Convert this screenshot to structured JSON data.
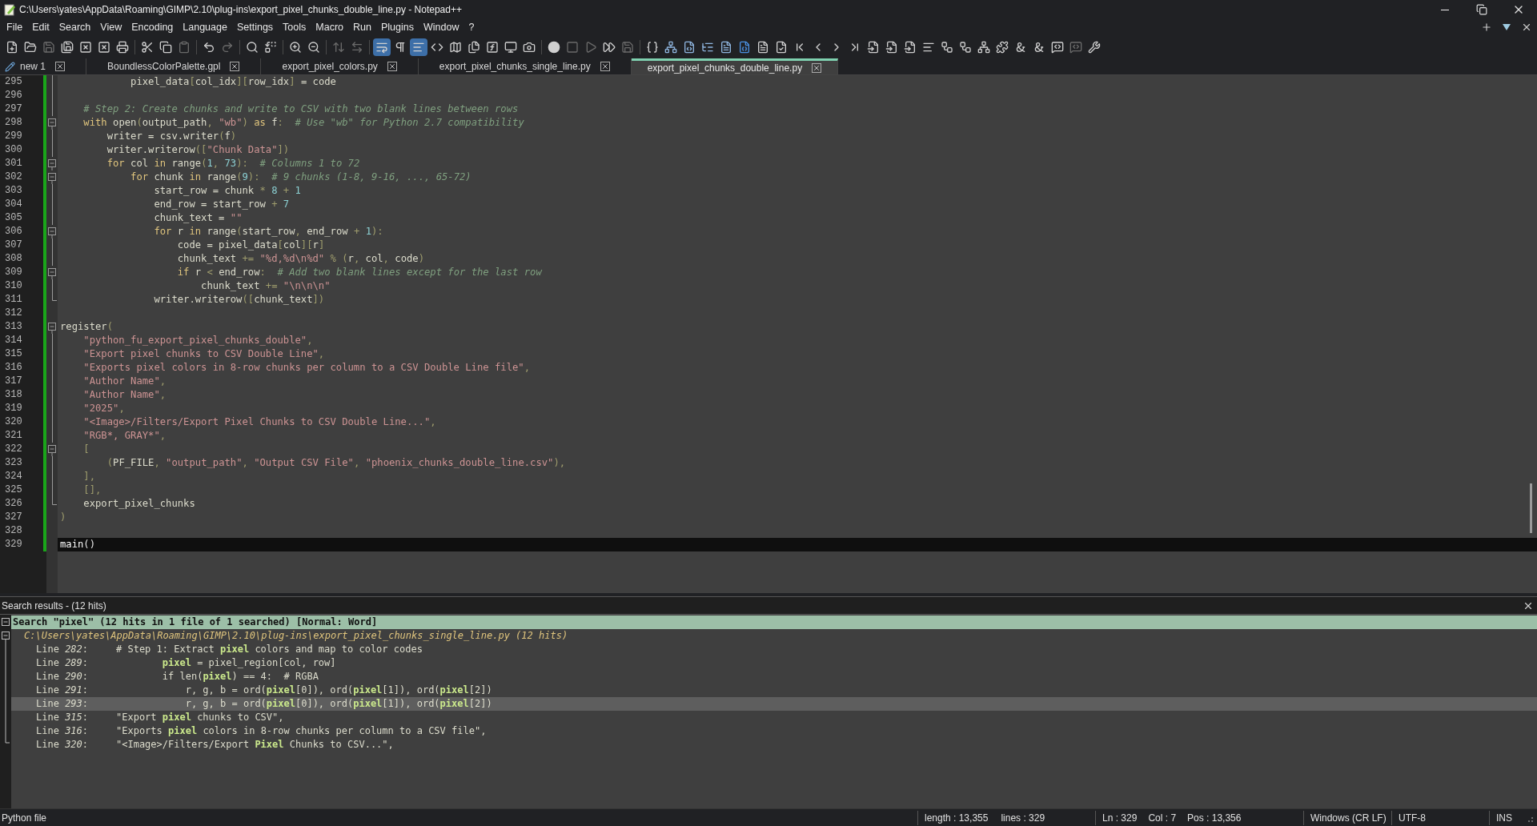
{
  "window": {
    "title": "C:\\Users\\yates\\AppData\\Roaming\\GIMP\\2.10\\plug-ins\\export_pixel_chunks_double_line.py - Notepad++"
  },
  "menu": [
    "File",
    "Edit",
    "Search",
    "View",
    "Encoding",
    "Language",
    "Settings",
    "Tools",
    "Macro",
    "Run",
    "Plugins",
    "Window",
    "?"
  ],
  "toolbar": {
    "word_wrap": {
      "on": true
    },
    "show_all_characters": {
      "on": false
    },
    "indent_guide": {
      "on": true
    }
  },
  "tabs": [
    {
      "label": "new 1",
      "kind": "unsaved",
      "selected": false
    },
    {
      "label": "BoundlessColorPalette.gpl",
      "kind": "file",
      "selected": false
    },
    {
      "label": "export_pixel_colors.py",
      "kind": "file",
      "selected": false
    },
    {
      "label": "export_pixel_chunks_single_line.py",
      "kind": "file",
      "selected": false
    },
    {
      "label": "export_pixel_chunks_double_line.py",
      "kind": "file",
      "selected": true
    }
  ],
  "editor": {
    "lines": [
      {
        "number": "295",
        "kind": "fold_mid",
        "current": false,
        "segments": [
          {
            "kind": "txt",
            "text": "            pixel_data"
          },
          {
            "kind": "op",
            "text": "["
          },
          {
            "kind": "txt",
            "text": "col_idx"
          },
          {
            "kind": "op",
            "text": "]["
          },
          {
            "kind": "txt",
            "text": "row_idx"
          },
          {
            "kind": "op",
            "text": "]"
          },
          {
            "kind": "txt",
            "text": " = code"
          }
        ]
      },
      {
        "number": "296",
        "kind": "fold_mid",
        "current": false
      },
      {
        "number": "297",
        "kind": "fold_mid",
        "current": false,
        "segments": [
          {
            "kind": "com",
            "text": "    # Step 2: Create chunks and write to CSV with two blank lines between rows"
          }
        ]
      },
      {
        "number": "298",
        "kind": "fold_start",
        "current": false,
        "segments": [
          {
            "kind": "kw",
            "text": "    with"
          },
          {
            "kind": "txt",
            "text": " open"
          },
          {
            "kind": "op",
            "text": "("
          },
          {
            "kind": "txt",
            "text": "output_path"
          },
          {
            "kind": "op",
            "text": ", "
          },
          {
            "kind": "str",
            "text": "\"wb\""
          },
          {
            "kind": "op",
            "text": ") "
          },
          {
            "kind": "kw",
            "text": "as"
          },
          {
            "kind": "txt",
            "text": " f"
          },
          {
            "kind": "op",
            "text": ":  "
          },
          {
            "kind": "com",
            "text": "# Use \"wb\" for Python 2.7 compatibility"
          }
        ]
      },
      {
        "number": "299",
        "kind": "fold_mid",
        "current": false,
        "segments": [
          {
            "kind": "txt",
            "text": "        writer = csv.writer"
          },
          {
            "kind": "op",
            "text": "("
          },
          {
            "kind": "txt",
            "text": "f"
          },
          {
            "kind": "op",
            "text": ")"
          }
        ]
      },
      {
        "number": "300",
        "kind": "fold_mid",
        "current": false,
        "segments": [
          {
            "kind": "txt",
            "text": "        writer.writerow"
          },
          {
            "kind": "op",
            "text": "(["
          },
          {
            "kind": "str",
            "text": "\"Chunk Data\""
          },
          {
            "kind": "op",
            "text": "])"
          }
        ]
      },
      {
        "number": "301",
        "kind": "fold_start",
        "current": false,
        "segments": [
          {
            "kind": "kw",
            "text": "        for"
          },
          {
            "kind": "txt",
            "text": " col "
          },
          {
            "kind": "kw",
            "text": "in"
          },
          {
            "kind": "txt",
            "text": " range"
          },
          {
            "kind": "op",
            "text": "("
          },
          {
            "kind": "num",
            "text": "1"
          },
          {
            "kind": "op",
            "text": ", "
          },
          {
            "kind": "num",
            "text": "73"
          },
          {
            "kind": "op",
            "text": "):  "
          },
          {
            "kind": "com",
            "text": "# Columns 1 to 72"
          }
        ]
      },
      {
        "number": "302",
        "kind": "fold_start",
        "current": false,
        "segments": [
          {
            "kind": "kw",
            "text": "            for"
          },
          {
            "kind": "txt",
            "text": " chunk "
          },
          {
            "kind": "kw",
            "text": "in"
          },
          {
            "kind": "txt",
            "text": " range"
          },
          {
            "kind": "op",
            "text": "("
          },
          {
            "kind": "num",
            "text": "9"
          },
          {
            "kind": "op",
            "text": "):  "
          },
          {
            "kind": "com",
            "text": "# 9 chunks (1-8, 9-16, ..., 65-72)"
          }
        ]
      },
      {
        "number": "303",
        "kind": "fold_mid",
        "current": false,
        "segments": [
          {
            "kind": "txt",
            "text": "                start_row = chunk "
          },
          {
            "kind": "op",
            "text": "* "
          },
          {
            "kind": "num",
            "text": "8"
          },
          {
            "kind": "op",
            "text": " + "
          },
          {
            "kind": "num",
            "text": "1"
          }
        ]
      },
      {
        "number": "304",
        "kind": "fold_mid",
        "current": false,
        "segments": [
          {
            "kind": "txt",
            "text": "                end_row = start_row "
          },
          {
            "kind": "op",
            "text": "+ "
          },
          {
            "kind": "num",
            "text": "7"
          }
        ]
      },
      {
        "number": "305",
        "kind": "fold_mid",
        "current": false,
        "segments": [
          {
            "kind": "txt",
            "text": "                chunk_text = "
          },
          {
            "kind": "str",
            "text": "\"\""
          }
        ]
      },
      {
        "number": "306",
        "kind": "fold_start",
        "current": false,
        "segments": [
          {
            "kind": "kw",
            "text": "                for"
          },
          {
            "kind": "txt",
            "text": " r "
          },
          {
            "kind": "kw",
            "text": "in"
          },
          {
            "kind": "txt",
            "text": " range"
          },
          {
            "kind": "op",
            "text": "("
          },
          {
            "kind": "txt",
            "text": "start_row"
          },
          {
            "kind": "op",
            "text": ", "
          },
          {
            "kind": "txt",
            "text": "end_row "
          },
          {
            "kind": "op",
            "text": "+ "
          },
          {
            "kind": "num",
            "text": "1"
          },
          {
            "kind": "op",
            "text": "):"
          }
        ]
      },
      {
        "number": "307",
        "kind": "fold_mid",
        "current": false,
        "segments": [
          {
            "kind": "txt",
            "text": "                    code = pixel_data"
          },
          {
            "kind": "op",
            "text": "["
          },
          {
            "kind": "txt",
            "text": "col"
          },
          {
            "kind": "op",
            "text": "]["
          },
          {
            "kind": "txt",
            "text": "r"
          },
          {
            "kind": "op",
            "text": "]"
          }
        ]
      },
      {
        "number": "308",
        "kind": "fold_mid",
        "current": false,
        "segments": [
          {
            "kind": "txt",
            "text": "                    chunk_text "
          },
          {
            "kind": "op",
            "text": "+= "
          },
          {
            "kind": "str",
            "text": "\"%d,%d\\n%d\""
          },
          {
            "kind": "op",
            "text": " % ("
          },
          {
            "kind": "txt",
            "text": "r"
          },
          {
            "kind": "op",
            "text": ", "
          },
          {
            "kind": "txt",
            "text": "col"
          },
          {
            "kind": "op",
            "text": ", "
          },
          {
            "kind": "txt",
            "text": "code"
          },
          {
            "kind": "op",
            "text": ")"
          }
        ]
      },
      {
        "number": "309",
        "kind": "fold_start",
        "current": false,
        "segments": [
          {
            "kind": "kw",
            "text": "                    if"
          },
          {
            "kind": "txt",
            "text": " r "
          },
          {
            "kind": "op",
            "text": "< "
          },
          {
            "kind": "txt",
            "text": "end_row"
          },
          {
            "kind": "op",
            "text": ":  "
          },
          {
            "kind": "com",
            "text": "# Add two blank lines except for the last row"
          }
        ]
      },
      {
        "number": "310",
        "kind": "fold_mid",
        "current": false,
        "segments": [
          {
            "kind": "txt",
            "text": "                        chunk_text "
          },
          {
            "kind": "op",
            "text": "+= "
          },
          {
            "kind": "str",
            "text": "\"\\n\\n\\n\""
          }
        ]
      },
      {
        "number": "311",
        "kind": "fold_end",
        "current": false,
        "segments": [
          {
            "kind": "txt",
            "text": "                writer.writerow"
          },
          {
            "kind": "op",
            "text": "(["
          },
          {
            "kind": "txt",
            "text": "chunk_text"
          },
          {
            "kind": "op",
            "text": "])"
          }
        ]
      },
      {
        "number": "312",
        "kind": "plain",
        "current": false
      },
      {
        "number": "313",
        "kind": "fold_start",
        "current": false,
        "segments": [
          {
            "kind": "txt",
            "text": "register"
          },
          {
            "kind": "op",
            "text": "("
          }
        ]
      },
      {
        "number": "314",
        "kind": "fold_mid",
        "current": false,
        "segments": [
          {
            "kind": "str",
            "text": "    \"python_fu_export_pixel_chunks_double\""
          },
          {
            "kind": "op",
            "text": ","
          }
        ]
      },
      {
        "number": "315",
        "kind": "fold_mid",
        "current": false,
        "segments": [
          {
            "kind": "str",
            "text": "    \"Export pixel chunks to CSV Double Line\""
          },
          {
            "kind": "op",
            "text": ","
          }
        ]
      },
      {
        "number": "316",
        "kind": "fold_mid",
        "current": false,
        "segments": [
          {
            "kind": "str",
            "text": "    \"Exports pixel colors in 8-row chunks per column to a CSV Double Line file\""
          },
          {
            "kind": "op",
            "text": ","
          }
        ]
      },
      {
        "number": "317",
        "kind": "fold_mid",
        "current": false,
        "segments": [
          {
            "kind": "str",
            "text": "    \"Author Name\""
          },
          {
            "kind": "op",
            "text": ","
          }
        ]
      },
      {
        "number": "318",
        "kind": "fold_mid",
        "current": false,
        "segments": [
          {
            "kind": "str",
            "text": "    \"Author Name\""
          },
          {
            "kind": "op",
            "text": ","
          }
        ]
      },
      {
        "number": "319",
        "kind": "fold_mid",
        "current": false,
        "segments": [
          {
            "kind": "str",
            "text": "    \"2025\""
          },
          {
            "kind": "op",
            "text": ","
          }
        ]
      },
      {
        "number": "320",
        "kind": "fold_mid",
        "current": false,
        "segments": [
          {
            "kind": "str",
            "text": "    \"<Image>/Filters/Export Pixel Chunks to CSV Double Line...\""
          },
          {
            "kind": "op",
            "text": ","
          }
        ]
      },
      {
        "number": "321",
        "kind": "fold_mid",
        "current": false,
        "segments": [
          {
            "kind": "str",
            "text": "    \"RGB*, GRAY*\""
          },
          {
            "kind": "op",
            "text": ","
          }
        ]
      },
      {
        "number": "322",
        "kind": "fold_start",
        "current": false,
        "segments": [
          {
            "kind": "op",
            "text": "    ["
          }
        ]
      },
      {
        "number": "323",
        "kind": "fold_mid",
        "current": false,
        "segments": [
          {
            "kind": "op",
            "text": "        ("
          },
          {
            "kind": "txt",
            "text": "PF_FILE"
          },
          {
            "kind": "op",
            "text": ", "
          },
          {
            "kind": "str",
            "text": "\"output_path\""
          },
          {
            "kind": "op",
            "text": ", "
          },
          {
            "kind": "str",
            "text": "\"Output CSV File\""
          },
          {
            "kind": "op",
            "text": ", "
          },
          {
            "kind": "str",
            "text": "\"phoenix_chunks_double_line.csv\""
          },
          {
            "kind": "op",
            "text": "),"
          }
        ]
      },
      {
        "number": "324",
        "kind": "fold_mid",
        "current": false,
        "segments": [
          {
            "kind": "op",
            "text": "    ],"
          }
        ]
      },
      {
        "number": "325",
        "kind": "fold_mid",
        "current": false,
        "segments": [
          {
            "kind": "op",
            "text": "    [],"
          }
        ]
      },
      {
        "number": "326",
        "kind": "fold_end",
        "current": false,
        "segments": [
          {
            "kind": "txt",
            "text": "    export_pixel_chunks"
          }
        ]
      },
      {
        "number": "327",
        "kind": "plain",
        "current": false,
        "segments": [
          {
            "kind": "op",
            "text": ")"
          }
        ]
      },
      {
        "number": "328",
        "kind": "plain",
        "current": false
      },
      {
        "number": "329",
        "kind": "plain",
        "current": true,
        "segments": [
          {
            "kind": "txt",
            "text": "main"
          },
          {
            "kind": "op",
            "text": "()"
          }
        ]
      }
    ]
  },
  "search_results": {
    "title": "Search results - (12 hits)",
    "header": "Search \"pixel\" (12 hits in 1 file of 1 searched) [Normal: Word]",
    "file": "C:\\Users\\yates\\AppData\\Roaming\\GIMP\\2.10\\plug-ins\\export_pixel_chunks_single_line.py (12 hits)",
    "hits": [
      {
        "label": "Line *282*:",
        "text": "# Step 1: Extract **pixel** colors and map to color codes",
        "selected": false
      },
      {
        "label": "Line *289*:",
        "text": "        **pixel** = pixel_region[col, row]",
        "selected": false
      },
      {
        "label": "Line *290*:",
        "text": "        if len(**pixel**) == 4:  # RGBA",
        "selected": false
      },
      {
        "label": "Line *291*:",
        "text": "            r, g, b = ord(**pixel**[0]), ord(**pixel**[1]), ord(**pixel**[2])",
        "selected": false
      },
      {
        "label": "Line *293*:",
        "text": "            r, g, b = ord(**pixel**[0]), ord(**pixel**[1]), ord(**pixel**[2])",
        "selected": true
      },
      {
        "label": "Line *315*:",
        "text": "\"Export **pixel** chunks to CSV\",",
        "selected": false
      },
      {
        "label": "Line *316*:",
        "text": "\"Exports **pixel** colors in 8-row chunks per column to a CSV file\",",
        "selected": false
      },
      {
        "label": "Line *320*:",
        "text": "\"<Image>/Filters/Export **Pixel** Chunks to CSV...\",",
        "selected": false
      }
    ]
  },
  "status_bar": {
    "file_type": "Python file",
    "length": "length : 13,355",
    "lines": "lines : 329",
    "ln": "Ln : 329",
    "col": "Col : 7",
    "pos": "Pos : 13,356",
    "eol": "Windows (CR LF)",
    "encoding": "UTF-8",
    "mode": "INS"
  }
}
